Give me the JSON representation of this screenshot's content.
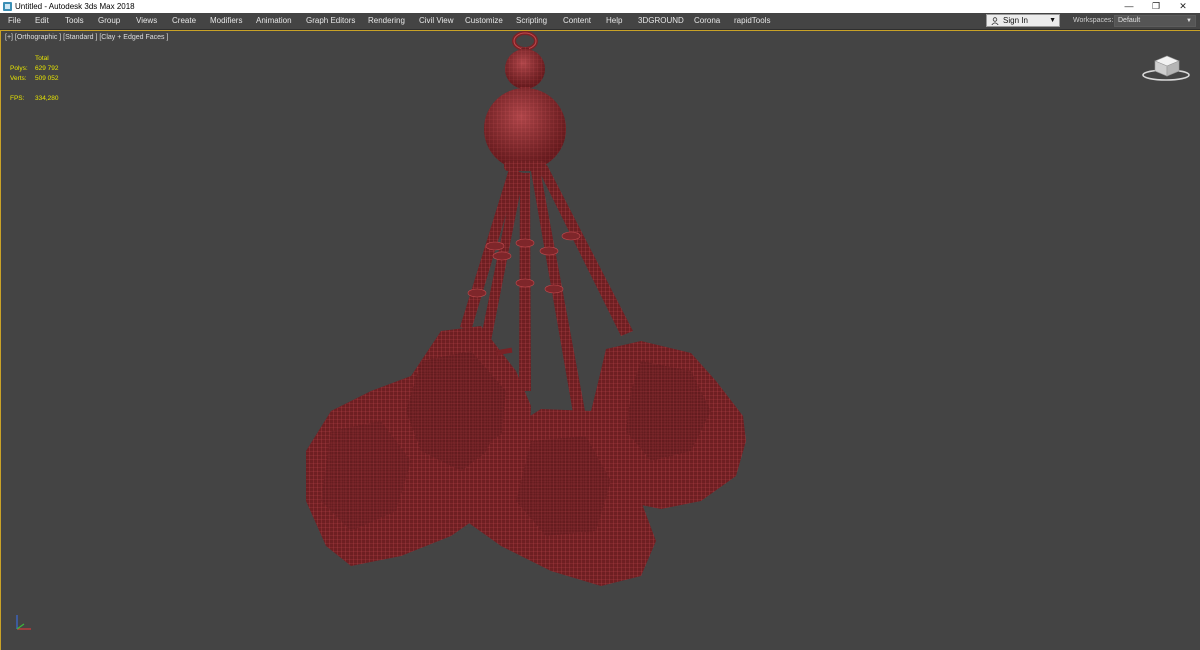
{
  "window": {
    "title": "Untitled - Autodesk 3ds Max 2018",
    "controls": [
      "—",
      "❐",
      "✕"
    ]
  },
  "menu": [
    "File",
    "Edit",
    "Tools",
    "Group",
    "Views",
    "Create",
    "Modifiers",
    "Animation",
    "Graph Editors",
    "Rendering",
    "Civil View",
    "Customize",
    "Scripting",
    "Content",
    "Help",
    "3DGROUND",
    "Corona",
    "rapidTools"
  ],
  "account": {
    "sign_in_label": "Sign In"
  },
  "workspaces": {
    "label": "Workspaces:",
    "value": "Default"
  },
  "viewport": {
    "label": "[+] [Orthographic ] [Standard ] [Clay + Edged Faces ]",
    "stats": {
      "header": "Total",
      "polys_label": "Polys:",
      "polys_value": "629 792",
      "verts_label": "Verts:",
      "verts_value": "509 052",
      "fps_label": "FPS:",
      "fps_value": "334,280"
    }
  },
  "colors": {
    "viewport_bg": "#444444",
    "mesh_fill": "#6e1f22",
    "mesh_wire": "#c0484c",
    "stats_text": "#e8e600",
    "active_border": "#c9a227"
  },
  "icons": [
    "app-icon",
    "user-icon",
    "viewcube-icon",
    "axis-tripod-icon"
  ]
}
